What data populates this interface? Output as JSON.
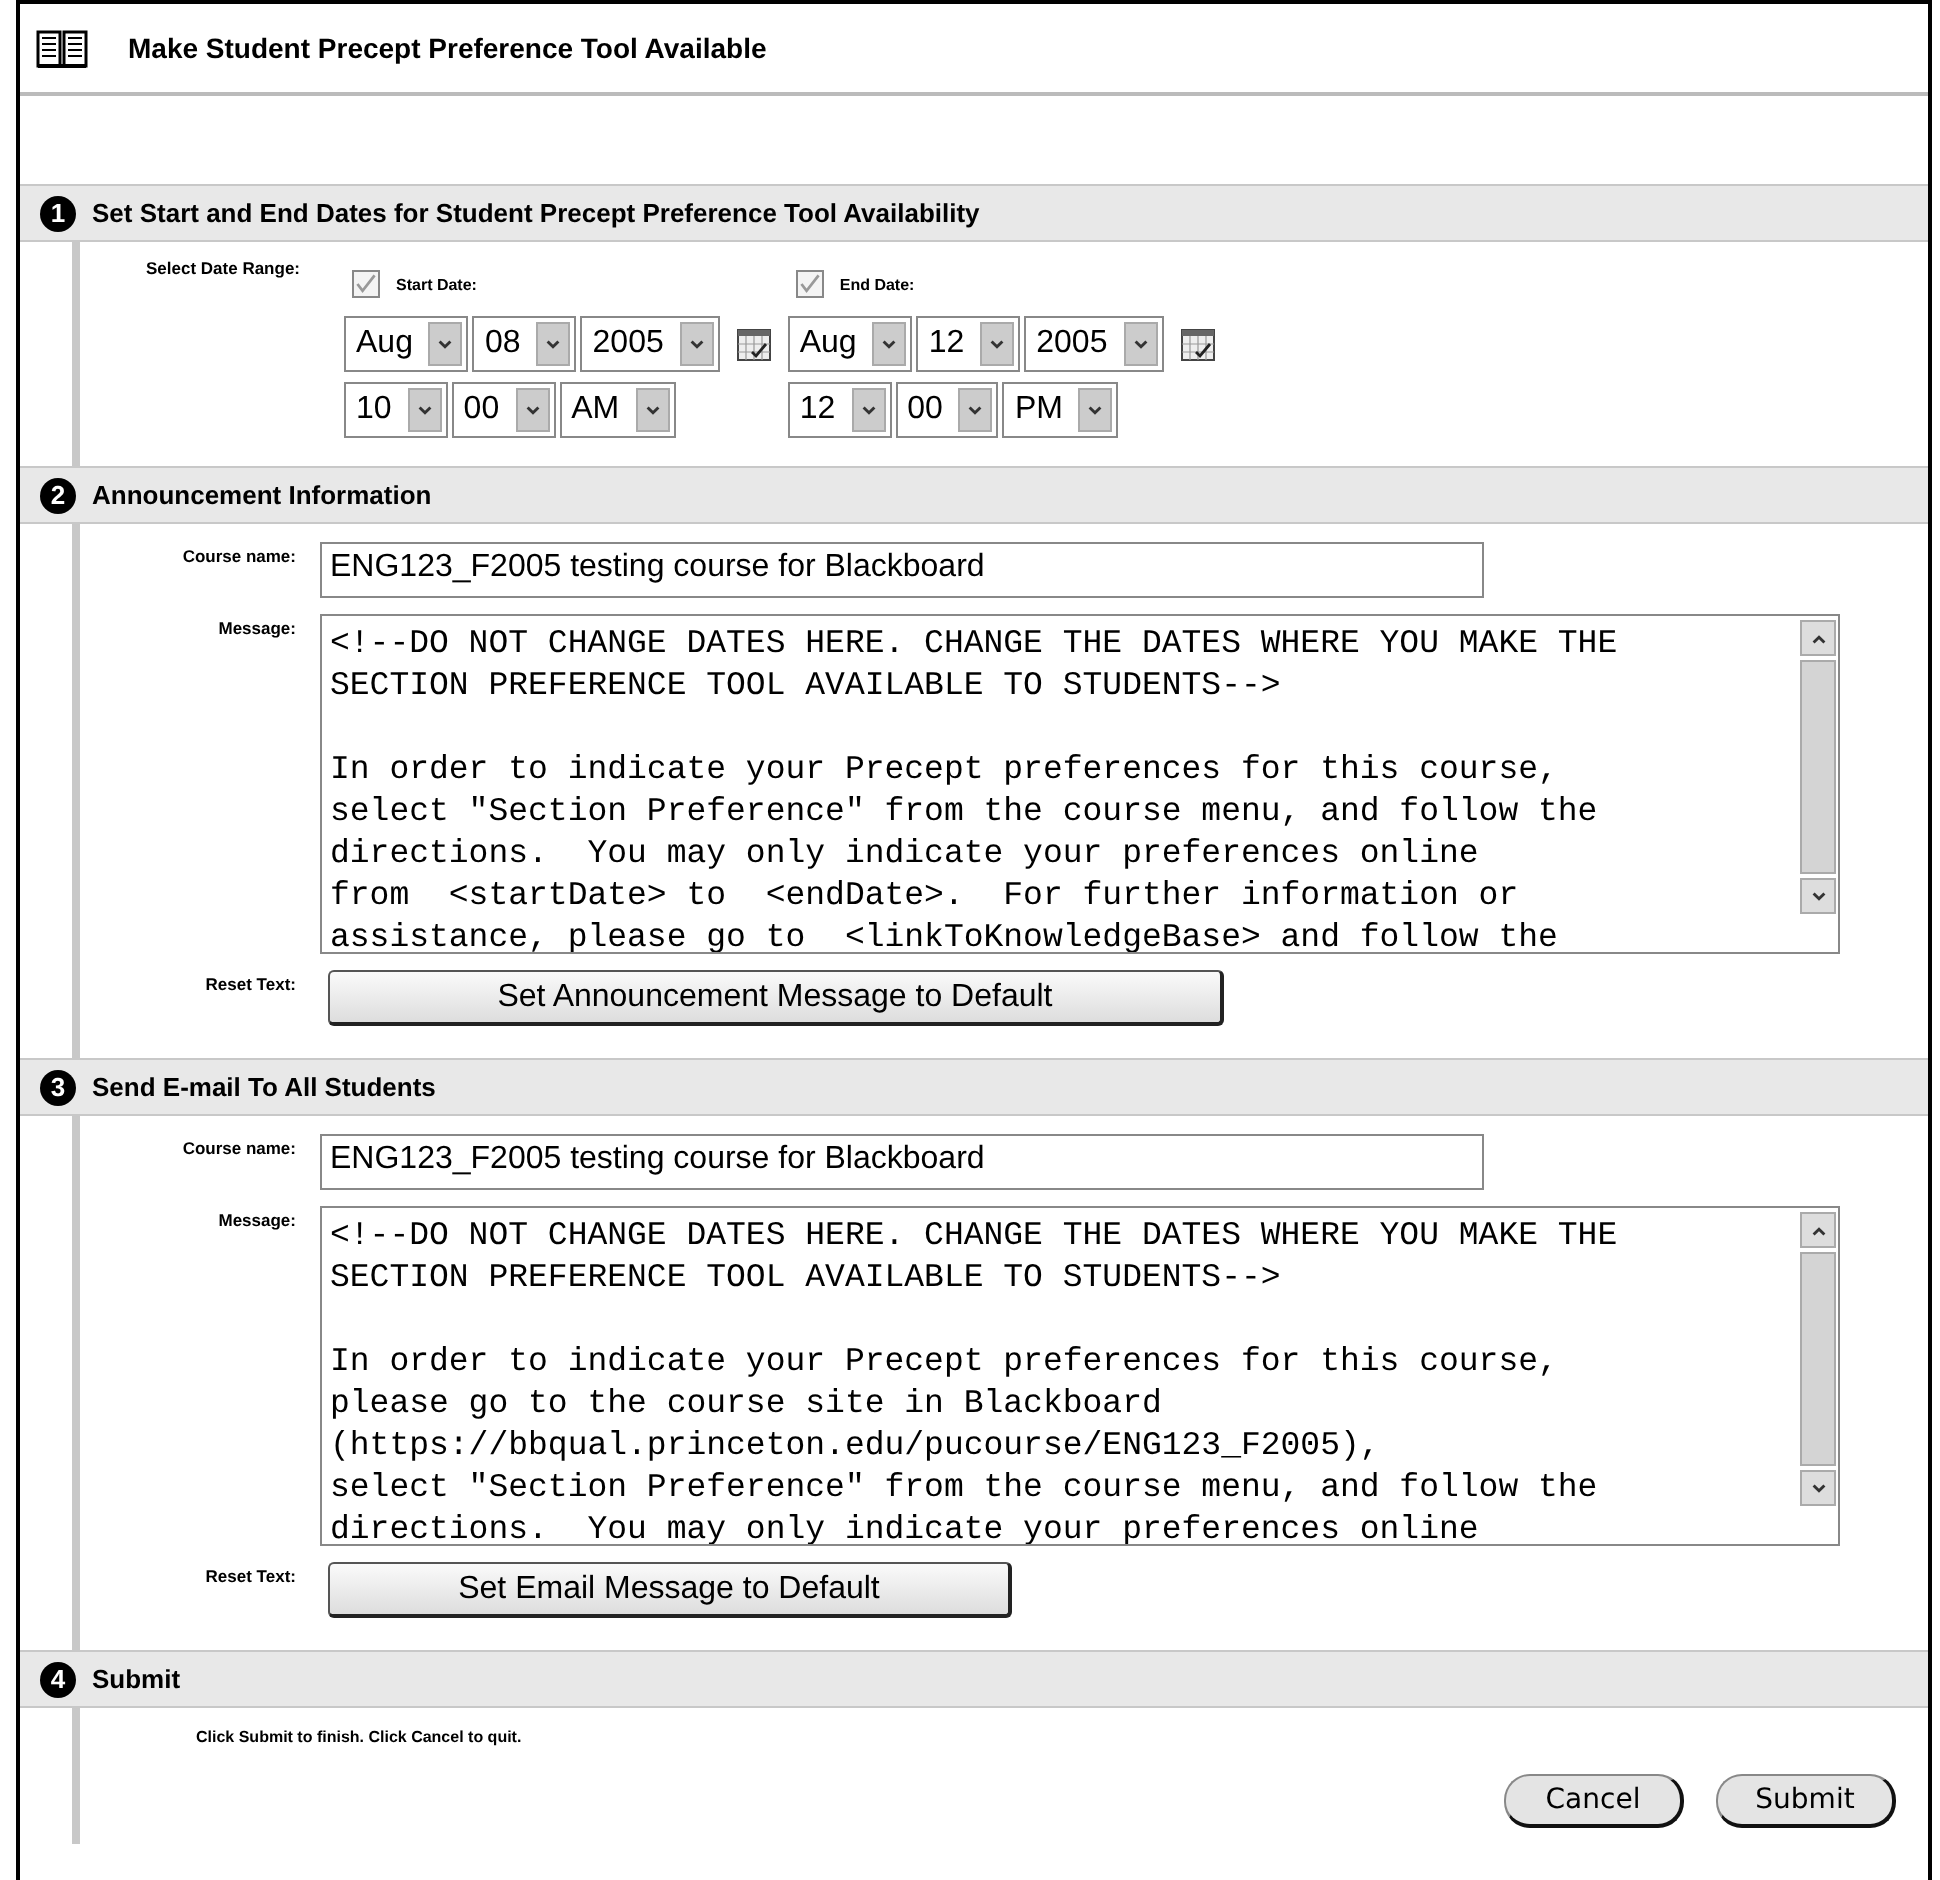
{
  "window": {
    "title": "Make Student Precept Preference Tool Available"
  },
  "sections": [
    {
      "number": "1",
      "title": "Set Start and End Dates for Student Precept Preference Tool Availability",
      "kind": "dates",
      "label": "Select Date Range:",
      "ranges": [
        {
          "label": "Start Date:",
          "checked": true,
          "date": [
            "Aug",
            "08",
            "2005"
          ],
          "time": [
            "10",
            "00",
            "AM"
          ]
        },
        {
          "label": "End Date:",
          "checked": true,
          "date": [
            "Aug",
            "12",
            "2005"
          ],
          "time": [
            "12",
            "00",
            "PM"
          ]
        }
      ]
    },
    {
      "number": "2",
      "title": "Announcement Information",
      "kind": "message",
      "course_label": "Course name:",
      "course_value": "ENG123_F2005 testing course for Blackboard",
      "message_label": "Message:",
      "message": "<!--DO NOT CHANGE DATES HERE. CHANGE THE DATES WHERE YOU MAKE THE\nSECTION PREFERENCE TOOL AVAILABLE TO STUDENTS-->\n\nIn order to indicate your Precept preferences for this course,\nselect \"Section Preference\" from the course menu, and follow the\ndirections.  You may only indicate your preferences online\nfrom  <startDate> to  <endDate>.  For further information or\nassistance, please go to  <linkToKnowledgeBase> and follow the",
      "reset_label": "Reset Text:",
      "reset_button": "Set Announcement Message to Default"
    },
    {
      "number": "3",
      "title": "Send E-mail To All Students",
      "kind": "message",
      "course_label": "Course name:",
      "course_value": "ENG123_F2005 testing course for Blackboard",
      "message_label": "Message:",
      "message": "<!--DO NOT CHANGE DATES HERE. CHANGE THE DATES WHERE YOU MAKE THE\nSECTION PREFERENCE TOOL AVAILABLE TO STUDENTS-->\n\nIn order to indicate your Precept preferences for this course,\nplease go to the course site in Blackboard\n(https://bbqual.princeton.edu/pucourse/ENG123_F2005),\nselect \"Section Preference\" from the course menu, and follow the\ndirections.  You may only indicate your preferences online",
      "reset_label": "Reset Text:",
      "reset_button": "Set Email Message to Default"
    },
    {
      "number": "4",
      "title": "Submit",
      "kind": "submit",
      "instruction": "Click Submit to finish. Click Cancel to quit.",
      "buttons": [
        "Cancel",
        "Submit"
      ]
    }
  ]
}
